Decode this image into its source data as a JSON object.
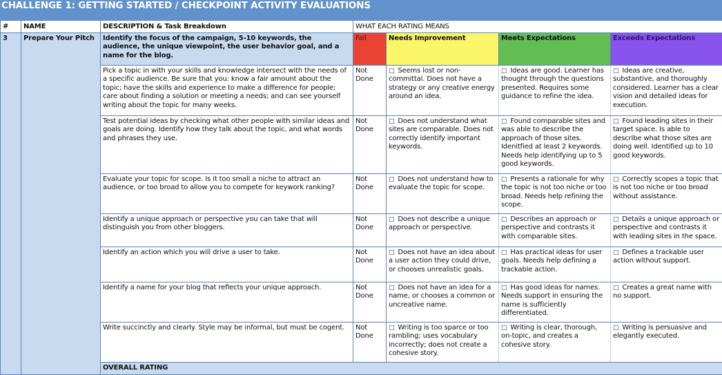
{
  "title": "CHALLENGE 1: GETTING STARTED / CHECKPOINT ACTIVITY EVALUATIONS",
  "headers": {
    "num": "#",
    "name": "NAME",
    "description": "DESCRIPTION & Task Breakdown",
    "ratings": "WHAT EACH RATING MEANS"
  },
  "colors": {
    "title_bar": "#6192cb",
    "row_blue": "#c7daef",
    "fail": "#ea4335",
    "needs_improvement": "#fbf568",
    "meets": "#62bd53",
    "exceeds": "#8753ec"
  },
  "activity": {
    "number": "3",
    "name": "Prepare Your Pitch",
    "summary": "Identify the focus of the campaign, 5-10 keywords, the audience, the unique viewpoint, the user behavior goal, and a name for the blog.",
    "rating_labels": {
      "fail": "Fail",
      "needs_improvement": "Needs Improvement",
      "meets": "Meets Expectations",
      "exceeds": "Exceeds Expectations"
    }
  },
  "checkbox_icon": "□",
  "tasks": [
    {
      "description": "Pick a topic in with your skills and knowledge intersect with the needs of a specific audience. Be sure that you: know a fair amount about the topic; have the skills and experience to make a difference for people; care about finding a solution or meeting a needs; and can see yourself writing about the topic for many weeks.",
      "status": "Not Done",
      "needs_improvement": "Seems lost or non-committal. Does not have a strategy or any creative energy around an idea.",
      "meets": "Ideas are good. Learner has thought through the questions presented. Requires some guidance to refine the idea.",
      "exceeds": "Ideas are creative, substantive, and thoroughly considered. Learner has a clear vision and detailed ideas for execution."
    },
    {
      "description": "Test potential ideas by checking what other people with similar ideas and goals are doing. Identify how they talk about the topic, and what words and phrases they use.",
      "status": "Not Done",
      "needs_improvement": "Does not understand what sites are comparable. Does not correctly identify important keywords.",
      "meets": "Found comparable sites and was able to describe the approach of those sites. Idenitfied at least 2 keywords. Needs help identifying up to 5 good keywords.",
      "exceeds": "Found leading sites in their target space. Is able to describe what those sites are doing well. Identified up to 10 good keywords."
    },
    {
      "description": "Evaluate your topic for scope. Is it too small a niche to attract an audience, or too broad to allow you to compete for keywork ranking?",
      "status": "Not Done",
      "needs_improvement": "Does not understand how to evaluate the topic for scope.",
      "meets": "Presents a rationale for why the topic is not too niche or too broad. Needs help refining the scope.",
      "exceeds": "Correctly scopes a topic that is not too niche or too broad without assistance."
    },
    {
      "description": "Identify a unique approach or perspective you can take that will distinguish you from other bloggers.",
      "status": "Not Done",
      "needs_improvement": "Does not describe a unique approach or perspective.",
      "meets": "Describes an approach or perspective and contrasts it with comparable sites.",
      "exceeds": "Details a unique approach or perspective and contrasts it with leading sites in the space."
    },
    {
      "description": "Identify an action which you will drive a user to take.",
      "status": "Not Done",
      "needs_improvement": "Does not have an idea about a user action they could drive, or chooses unrealistic goals.",
      "meets": "Has practical ideas for user goals. Needs help defining a trackable action.",
      "exceeds": "Defines a trackable user action without support."
    },
    {
      "description": "Identify a name for your blog that reflects your unique approach.",
      "status": "Not Done",
      "needs_improvement": "Does not have an idea for a name, or chooses a common or uncreative name.",
      "meets": "Has good ideas for names. Needs support in ensuring the name is sufficiently differentiated.",
      "exceeds": "Creates a great name with no support."
    },
    {
      "description": "Write succinctly and clearly. Style may be informal, but must be cogent.",
      "status": "Not Done",
      "needs_improvement": "Writing is  too sparce or too rambling; uses vocabulary incorrectly; does not create a cohesive story.",
      "meets": "Writing is clear, thorough, on-topic, and creates a cohesive story.",
      "exceeds": "Writing is persuasive and elegantly executed."
    }
  ],
  "overall_rating_label": "OVERALL RATING"
}
